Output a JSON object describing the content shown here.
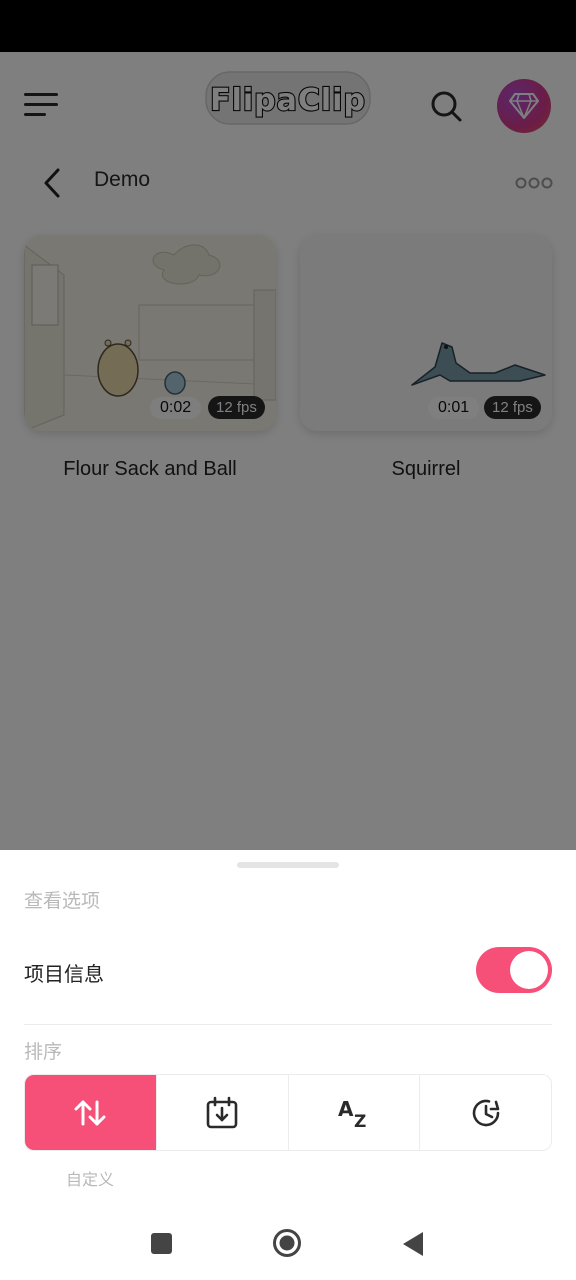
{
  "app": {
    "logo_text": "FlipaClip"
  },
  "breadcrumb": {
    "title": "Demo"
  },
  "projects": [
    {
      "title": "Flour Sack and Ball",
      "duration": "0:02",
      "fps": "12 fps"
    },
    {
      "title": "Squirrel",
      "duration": "0:01",
      "fps": "12 fps"
    }
  ],
  "sheet": {
    "view_options_label": "查看选项",
    "project_info_label": "项目信息",
    "project_info_enabled": true,
    "sort_label": "排序",
    "sort_options": [
      {
        "icon": "swap-vertical-icon",
        "selected": true
      },
      {
        "icon": "calendar-download-icon",
        "selected": false
      },
      {
        "icon": "alphabetical-sort-icon",
        "selected": false
      },
      {
        "icon": "recent-history-icon",
        "selected": false
      }
    ],
    "selected_sort_caption": "自定义"
  },
  "colors": {
    "accent": "#f64f78",
    "overlay": "rgba(0,0,0,0.5)",
    "premium_gradient": [
      "#b34fd8",
      "#e85a5a"
    ]
  }
}
